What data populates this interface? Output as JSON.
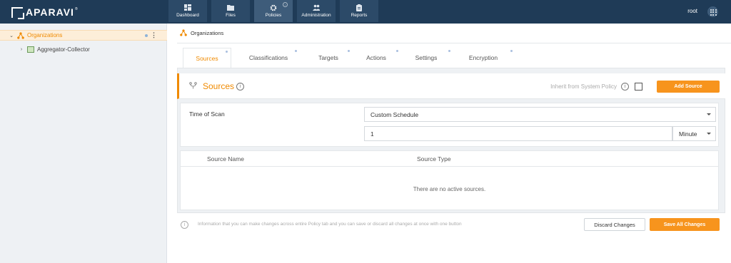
{
  "brand": {
    "name": "APARAVI",
    "trademark": "®"
  },
  "nav": [
    {
      "label": "Dashboard",
      "icon": "dashboard-icon"
    },
    {
      "label": "Files",
      "icon": "folder-icon"
    },
    {
      "label": "Policies",
      "icon": "gear-icon",
      "active": true
    },
    {
      "label": "Administration",
      "icon": "users-icon"
    },
    {
      "label": "Reports",
      "icon": "clipboard-icon"
    }
  ],
  "user": {
    "name": "root"
  },
  "sidebar": {
    "items": [
      {
        "label": "Organizations",
        "selected": true
      },
      {
        "label": "Aggregator-Collector"
      }
    ]
  },
  "breadcrumb": {
    "label": "Organizations"
  },
  "tabs": [
    {
      "label": "Sources",
      "active": true
    },
    {
      "label": "Classifications"
    },
    {
      "label": "Targets"
    },
    {
      "label": "Actions"
    },
    {
      "label": "Settings"
    },
    {
      "label": "Encryption"
    }
  ],
  "section": {
    "title": "Sources",
    "inherit_label": "Inherit from System Policy",
    "inherit_checked": false,
    "add_button": "Add Source"
  },
  "schedule": {
    "label": "Time of Scan",
    "type": "Custom Schedule",
    "interval": "1",
    "unit": "Minute"
  },
  "table": {
    "columns": [
      "Source Name",
      "Source Type"
    ],
    "empty_text": "There are no active sources."
  },
  "footer": {
    "info_text": "Information that you can make changes across entire Policy tab and you can save or discard all changes at once with one button",
    "discard_button": "Discard Changes",
    "save_button": "Save All Changes"
  },
  "colors": {
    "accent": "#f7941d",
    "topbar": "#1f3b57"
  }
}
